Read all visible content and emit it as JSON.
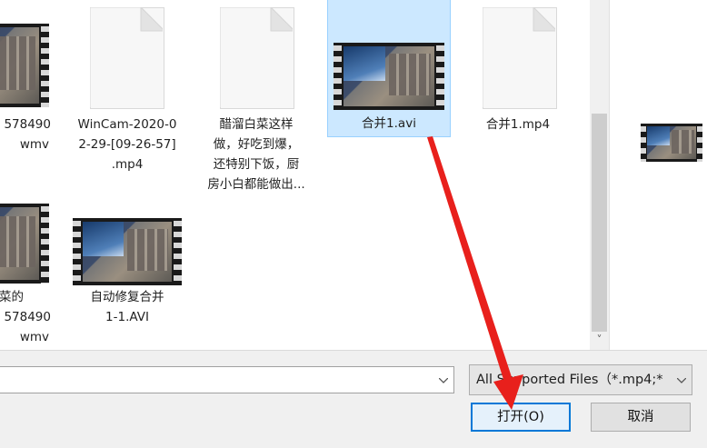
{
  "files": [
    {
      "label_lines": [
        "578490",
        "wmv"
      ],
      "selected": false,
      "kind": "video"
    },
    {
      "label_lines": [
        "WinCam-2020-0",
        "2-29-[09-26-57]",
        ".mp4"
      ],
      "selected": false,
      "kind": "document"
    },
    {
      "label_lines": [
        "醋溜白菜这样",
        "做，好吃到爆，",
        "还特别下饭，厨",
        "房小白都能做出..."
      ],
      "selected": false,
      "kind": "document"
    },
    {
      "label_lines": [
        "合并1.avi"
      ],
      "selected": true,
      "kind": "video"
    },
    {
      "label_lines": [
        "合并1.mp4"
      ],
      "selected": false,
      "kind": "document"
    },
    {
      "label_lines": [
        "菜的",
        "578490",
        "wmv"
      ],
      "selected": false,
      "kind": "video"
    },
    {
      "label_lines": [
        "自动修复合并",
        "1-1.AVI"
      ],
      "selected": false,
      "kind": "video"
    }
  ],
  "scrollbar": {
    "down_arrow": "˅"
  },
  "file_name": {
    "value": "",
    "dropdown_icon": "chevron-down-icon"
  },
  "file_type": {
    "selected": "All Supported Files（*.mp4;*",
    "dropdown_icon": "chevron-down-icon"
  },
  "buttons": {
    "open": "打开(O)",
    "cancel": "取消"
  },
  "colors": {
    "selection": "#cce8ff",
    "accent": "#0078d7",
    "annotation_arrow": "#e8201c"
  }
}
